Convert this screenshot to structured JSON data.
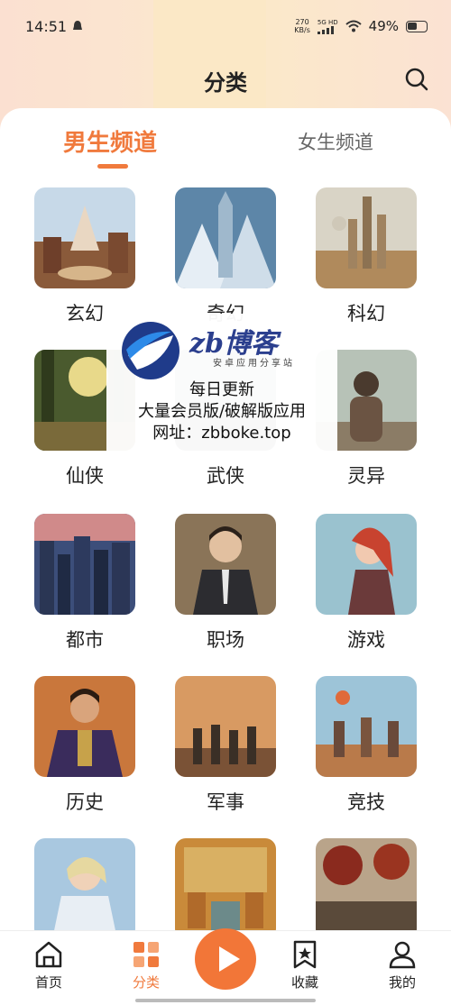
{
  "status": {
    "time": "14:51",
    "net_speed_value": "270",
    "net_speed_unit": "KB/s",
    "signal_label": "5G HD",
    "battery": "49%"
  },
  "header": {
    "title": "分类",
    "search_icon": "search-icon"
  },
  "tabs": [
    {
      "label": "男生频道",
      "active": true
    },
    {
      "label": "女生频道",
      "active": false
    }
  ],
  "categories": [
    {
      "label": "玄幻"
    },
    {
      "label": "奇幻"
    },
    {
      "label": "科幻"
    },
    {
      "label": "仙侠"
    },
    {
      "label": "武侠"
    },
    {
      "label": "灵异"
    },
    {
      "label": "都市"
    },
    {
      "label": "职场"
    },
    {
      "label": "游戏"
    },
    {
      "label": "历史"
    },
    {
      "label": "军事"
    },
    {
      "label": "竞技"
    },
    {
      "label": ""
    },
    {
      "label": ""
    },
    {
      "label": ""
    }
  ],
  "watermark": {
    "brand": "zb博客",
    "tagline": "安卓应用分享站",
    "line1": "每日更新",
    "line2": "大量会员版/破解版应用",
    "line3": "网址：zbboke.top"
  },
  "bottom_nav": [
    {
      "label": "首页",
      "icon": "home-icon"
    },
    {
      "label": "分类",
      "icon": "category-icon"
    },
    {
      "label": "收藏",
      "icon": "bookmark-icon"
    },
    {
      "label": "我的",
      "icon": "profile-icon"
    }
  ],
  "colors": {
    "accent": "#f07a3d",
    "header_bg": "#fbe6cf"
  }
}
